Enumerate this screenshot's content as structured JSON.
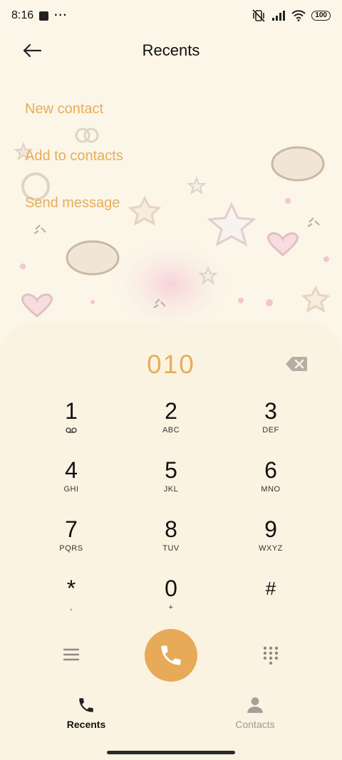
{
  "status_bar": {
    "time": "8:16",
    "more": "···",
    "battery": "100"
  },
  "header": {
    "title": "Recents"
  },
  "menu": [
    {
      "label": "New contact"
    },
    {
      "label": "Add to contacts"
    },
    {
      "label": "Send message"
    }
  ],
  "dialer": {
    "number": "010",
    "keys": [
      {
        "digit": "1",
        "letters": ""
      },
      {
        "digit": "2",
        "letters": "ABC"
      },
      {
        "digit": "3",
        "letters": "DEF"
      },
      {
        "digit": "4",
        "letters": "GHI"
      },
      {
        "digit": "5",
        "letters": "JKL"
      },
      {
        "digit": "6",
        "letters": "MNO"
      },
      {
        "digit": "7",
        "letters": "PQRS"
      },
      {
        "digit": "8",
        "letters": "TUV"
      },
      {
        "digit": "9",
        "letters": "WXYZ"
      },
      {
        "digit": "*",
        "letters": ","
      },
      {
        "digit": "0",
        "letters": "+"
      },
      {
        "digit": "#",
        "letters": ""
      }
    ]
  },
  "nav": {
    "recents": "Recents",
    "contacts": "Contacts"
  },
  "colors": {
    "accent": "#e8ad5a",
    "call_button": "#e6aa59",
    "background": "#fbf6e8"
  }
}
